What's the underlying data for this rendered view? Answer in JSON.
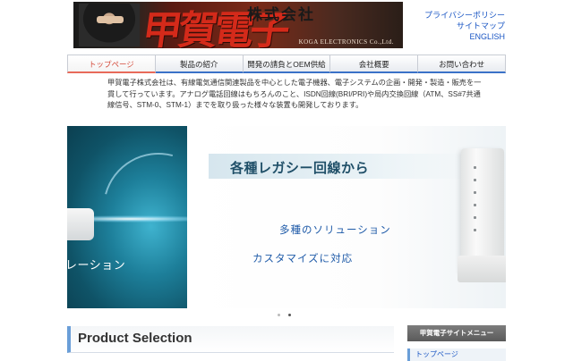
{
  "header": {
    "logo_mark": "甲賀電子",
    "company_type": "株式会社",
    "company_en": "KOGA ELECTRONICS Co.,Ltd.",
    "links": [
      "プライバシーポリシー",
      "サイトマップ",
      "ENGLISH"
    ]
  },
  "nav": {
    "items": [
      "トップページ",
      "製品の紹介",
      "開発の請負とOEM供給",
      "会社概要",
      "お問い合わせ"
    ],
    "active_index": 0
  },
  "intro": {
    "text": "甲賀電子株式会社は、有線電気通信関連製品を中心とした電子機器、電子システムの企画・開発・製造・販売を一貫して行っています。アナログ電話回線はもちろんのこと、ISDN回線(BRI/PRI)や局内交換回線（ATM、SS#7共通線信号、STM-0、STM-1）までを取り扱った様々な装置も開発しております。"
  },
  "hero": {
    "left_text": "レーション",
    "title": "各種レガシー回線から",
    "line1": "多種のソリューション",
    "line2": "カスタマイズに対応",
    "slides": 2,
    "active_slide": 1
  },
  "section": {
    "title": "Product Selection"
  },
  "sidebar": {
    "heading": "甲賀電子サイトメニュー",
    "first_item": "トップページ"
  },
  "colors": {
    "accent_blue": "#3a72c8",
    "link": "#1a56c4",
    "logo_red": "#d42a1a"
  }
}
